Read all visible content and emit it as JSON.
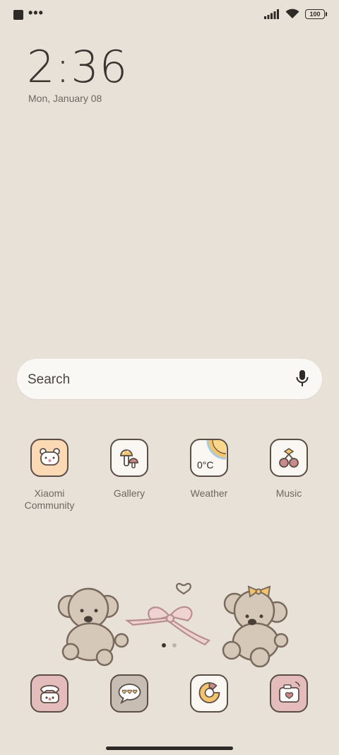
{
  "status_bar": {
    "battery": "100",
    "icons": [
      "notification-square-icon",
      "more-dots-icon",
      "signal-icon",
      "wifi-icon",
      "battery-icon"
    ],
    "dots": "•••"
  },
  "lock": {
    "time": "2:36",
    "date": "Mon, January 08"
  },
  "search": {
    "placeholder": "Search",
    "icon": "mic-icon"
  },
  "apps": [
    {
      "label": "Xiaomi\nCommunity",
      "icon": "bear-icon",
      "color": "#fbd9b5"
    },
    {
      "label": "Gallery",
      "icon": "mushroom-icon",
      "color": "#faf7f2"
    },
    {
      "label": "Weather",
      "icon": "sun-icon",
      "color": "#faf7f2",
      "value": "0°C"
    },
    {
      "label": "Music",
      "icon": "cherry-icon",
      "color": "#faf7f2"
    }
  ],
  "dock": [
    {
      "icon": "phone-icon",
      "color": "#e4bcbc"
    },
    {
      "icon": "message-icon",
      "color": "#c8bdb2"
    },
    {
      "icon": "browser-icon",
      "color": "#faf7f2"
    },
    {
      "icon": "camera-icon",
      "color": "#e4bcbc"
    }
  ],
  "pager": {
    "pages": 2,
    "current": 1
  },
  "colors": {
    "background": "#e8e1d8",
    "search_bg": "#faf8f5",
    "icon_outline": "#5a4d46"
  }
}
